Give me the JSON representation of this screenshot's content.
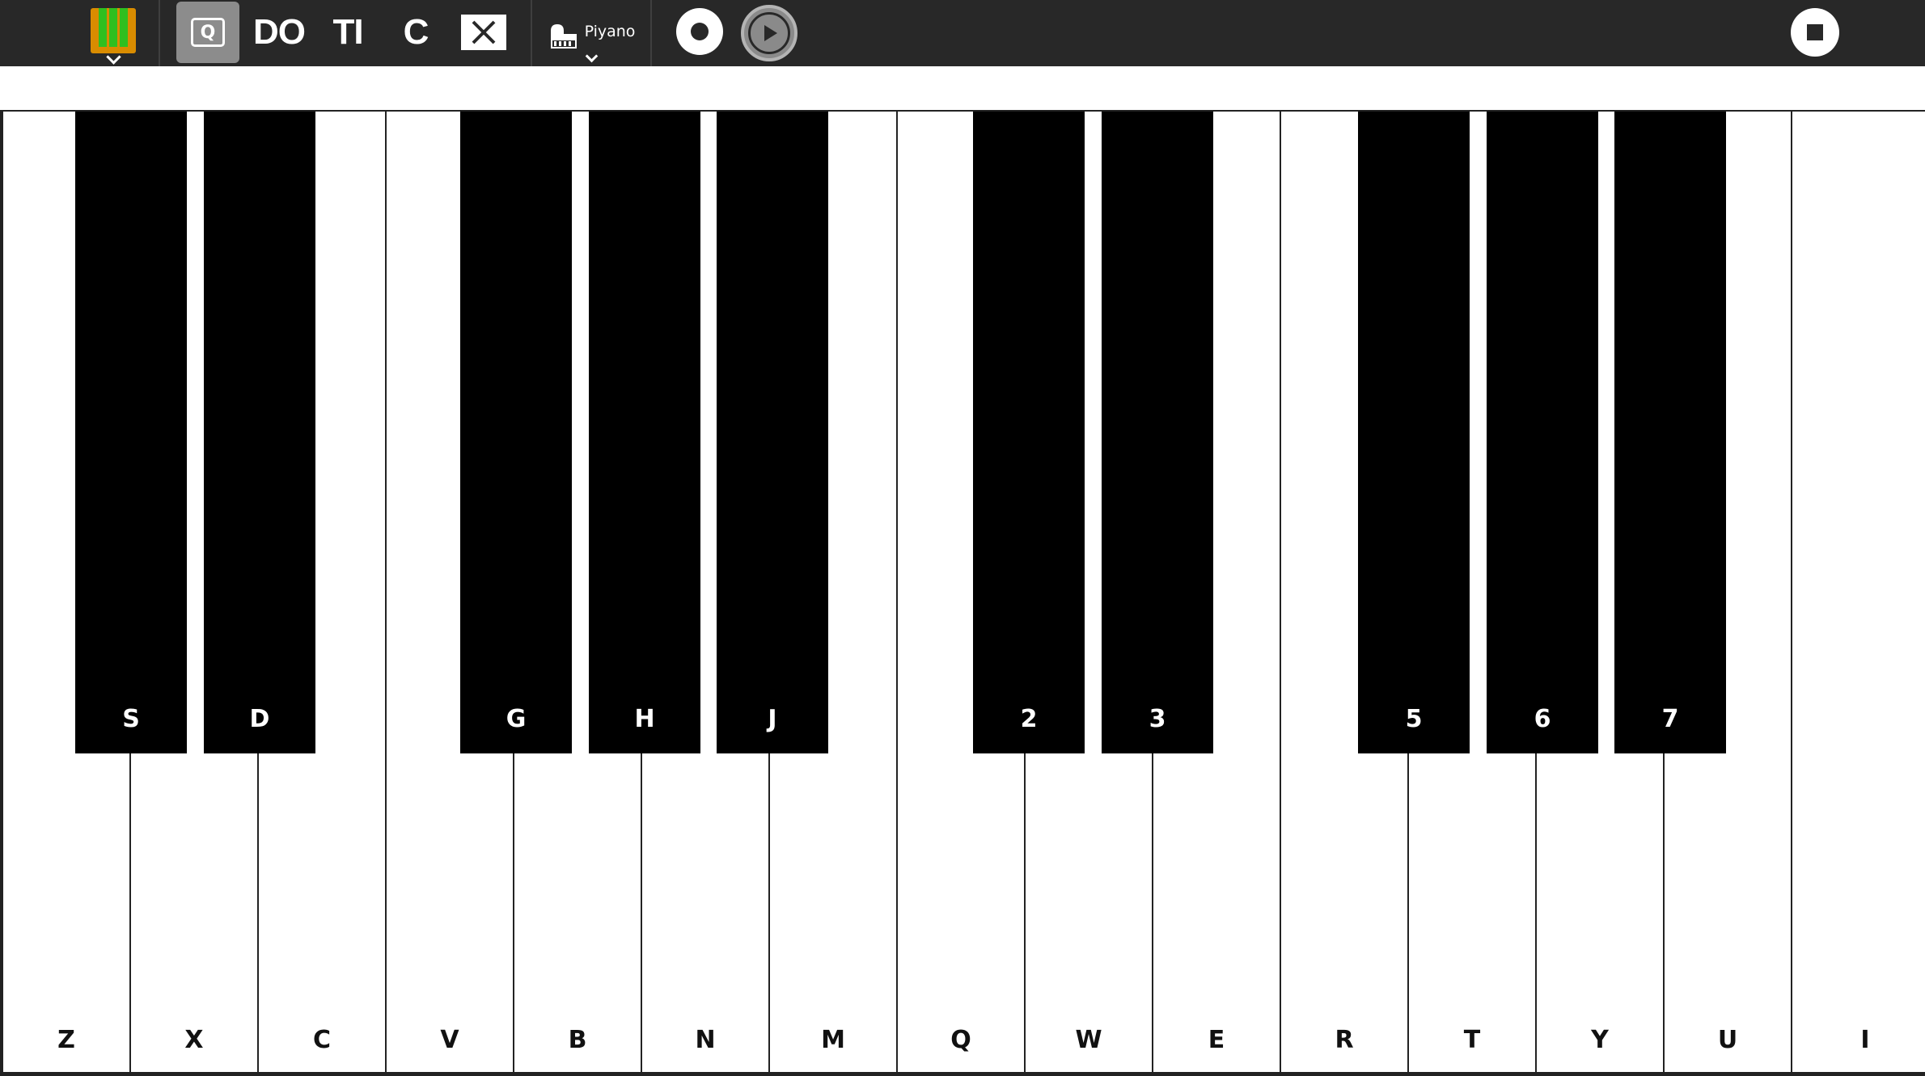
{
  "toolbar": {
    "title_buttons": {
      "do_label": "DO",
      "ti_label": "TI",
      "c_label": "C"
    },
    "instrument_label": "Piyano",
    "colors": {
      "toolbar_bg": "#282828",
      "activity_orange": "#d98c00",
      "activity_green": "#2fbf1f",
      "selected_button": "#8c8c8c"
    },
    "icons": [
      "activity-icon",
      "keyboard-mode-icon",
      "clear-icon",
      "piano-icon",
      "record-icon",
      "play-icon",
      "stop-icon"
    ]
  },
  "keyboard": {
    "white_keys": [
      "Z",
      "X",
      "C",
      "V",
      "B",
      "N",
      "M",
      "Q",
      "W",
      "E",
      "R",
      "T",
      "Y",
      "U",
      "I"
    ],
    "black_keys": [
      "S",
      "D",
      "G",
      "H",
      "J",
      "2",
      "3",
      "5",
      "6",
      "7"
    ]
  }
}
